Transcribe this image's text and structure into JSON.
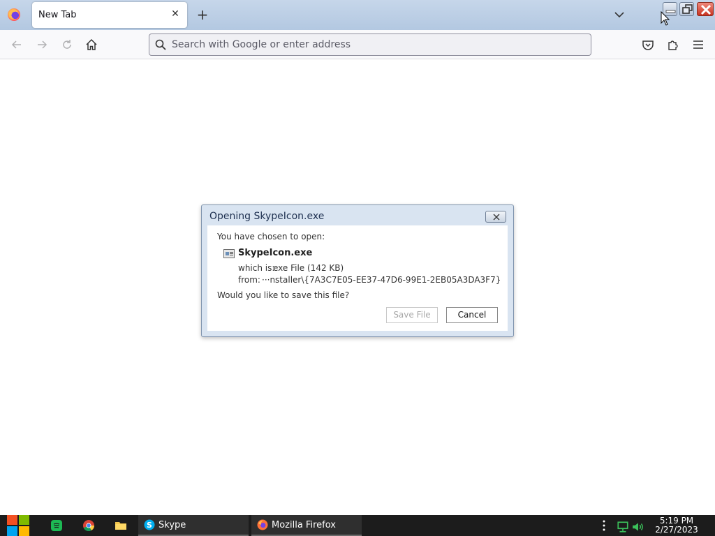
{
  "browser": {
    "tab_title": "New Tab",
    "url_placeholder": "Search with Google or enter address"
  },
  "dialog": {
    "title": "Opening SkypeIcon.exe",
    "chosen_text": "You have chosen to open:",
    "file_name": "SkypeIcon.exe",
    "which_is_label": "which is:",
    "which_is_value": "exe File (142 KB)",
    "from_label": "from:",
    "from_value": "···nstaller\\{7A3C7E05-EE37-47D6-99E1-2EB05A3DA3F7}",
    "question": "Would you like to save this file?",
    "save_button": "Save File",
    "cancel_button": "Cancel"
  },
  "taskbar": {
    "items": [
      {
        "label": "Skype",
        "icon": "skype-icon"
      },
      {
        "label": "Mozilla Firefox",
        "icon": "firefox-icon"
      }
    ],
    "pinned": [
      "start-icon",
      "spotify-icon",
      "chrome-icon",
      "file-explorer-icon"
    ],
    "time": "5:19 PM",
    "date": "2/27/2023"
  },
  "colors": {
    "accent_blue": "#0060df",
    "titlebar": "#b8cce4",
    "taskbar": "#1c1c1c"
  }
}
